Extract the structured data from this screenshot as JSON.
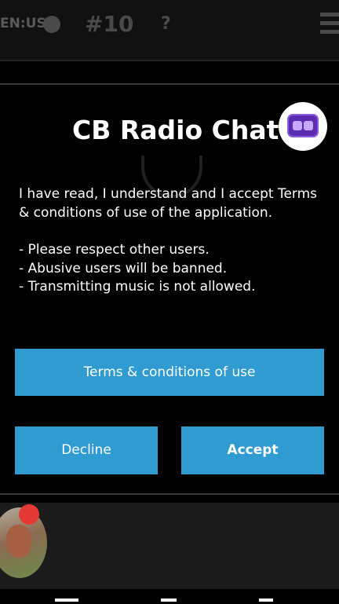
{
  "topbar": {
    "language_label": "EN:US",
    "globe_icon": "globe-icon",
    "channel_label": "#10",
    "users_count": "?",
    "users_icon": "users-icon",
    "menu_icon": "hamburger-menu-icon"
  },
  "dialog": {
    "title": "CB Radio Chat",
    "logo_icon": "chat-bubble-app-icon",
    "message_intro": "I have read, I understand and I accept Terms & conditions of use of the application.",
    "rules": [
      "- Please respect other users.",
      "- Abusive users will be banned.",
      "- Transmitting music is not allowed."
    ],
    "terms_button": "Terms & conditions of use",
    "decline_button": "Decline",
    "accept_button": "Accept"
  },
  "colors": {
    "button_blue": "#2f9bd1",
    "logo_purple": "#5b2bb0",
    "badge_red": "#e53935"
  }
}
